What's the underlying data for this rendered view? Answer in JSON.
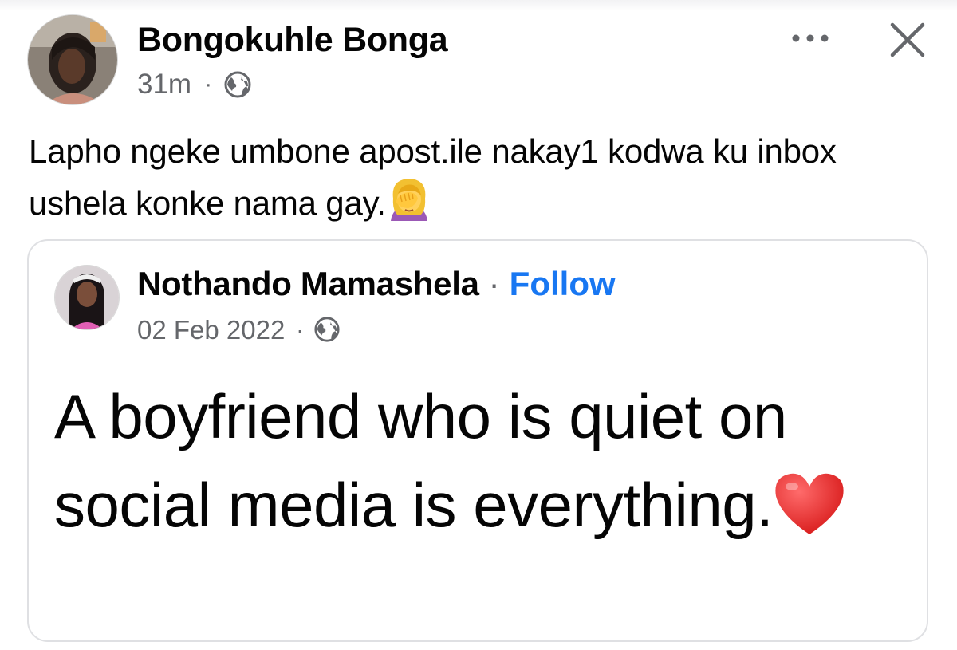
{
  "post": {
    "author_name": "Bongokuhle Bonga",
    "time": "31m",
    "separator": "·",
    "audience_icon": "globe-icon",
    "more_icon": "more-options-icon",
    "close_icon": "close-icon",
    "caption_text": "Lapho ngeke umbone apost.ile nakay1 kodwa ku inbox ushela konke nama gay.",
    "caption_emoji": "face-palm-emoji"
  },
  "shared_post": {
    "author_name": "Nothando Mamashela",
    "separator": "·",
    "follow_label": "Follow",
    "date": "02 Feb 2022",
    "audience_icon": "globe-icon",
    "text": "A boyfriend who is quiet on social media is everything.",
    "text_emoji": "red-heart-emoji"
  },
  "colors": {
    "link_blue": "#1877f2",
    "secondary_text": "#65676b",
    "primary_text": "#050505",
    "card_border": "#dfe0e3"
  }
}
